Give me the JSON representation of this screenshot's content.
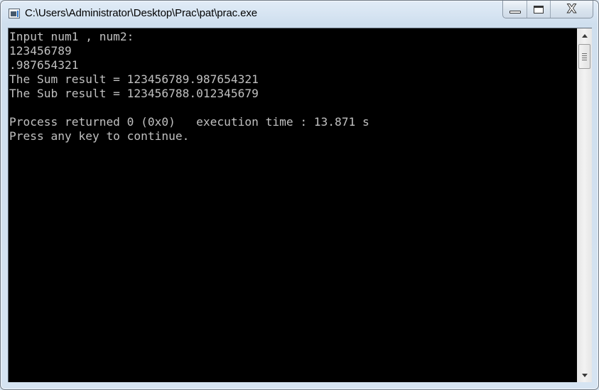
{
  "window": {
    "title": "C:\\Users\\Administrator\\Desktop\\Prac\\pat\\prac.exe",
    "icon": "console-app-icon",
    "caption_buttons": {
      "minimize": "minimize-icon",
      "maximize": "maximize-icon",
      "close": "close-icon",
      "close_glyph": "X"
    }
  },
  "console": {
    "background": "#000000",
    "foreground": "#c0c0c0",
    "lines": [
      "Input num1 , num2:",
      "123456789",
      ".987654321",
      "The Sum result = 123456789.987654321",
      "The Sub result = 123456788.012345679",
      "",
      "Process returned 0 (0x0)   execution time : 13.871 s",
      "Press any key to continue."
    ]
  },
  "scrollbar": {
    "up_icon": "arrow-up-icon",
    "down_icon": "arrow-down-icon",
    "position": 0
  }
}
